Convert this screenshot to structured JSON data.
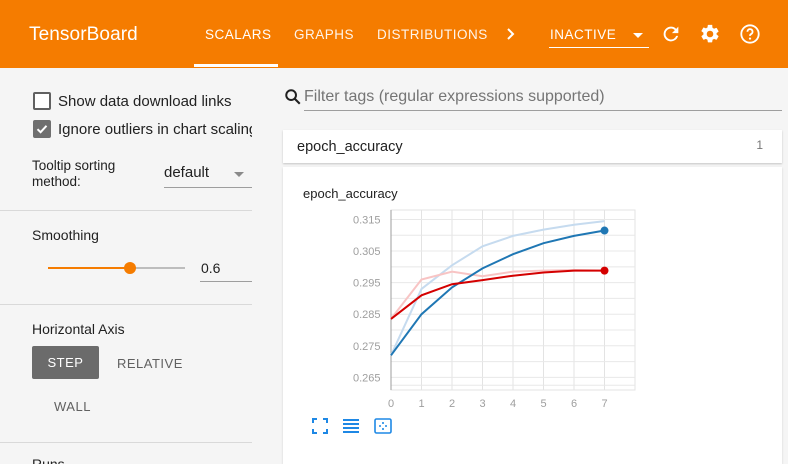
{
  "header": {
    "brand": "TensorBoard",
    "tabs": [
      {
        "label": "SCALARS",
        "active": true
      },
      {
        "label": "GRAPHS",
        "active": false
      },
      {
        "label": "DISTRIBUTIONS",
        "active": false
      }
    ],
    "status_select": "INACTIVE",
    "icons": [
      "chevron-right-icon",
      "refresh-icon",
      "settings-icon",
      "help-icon"
    ],
    "bar_color": "#f57c00"
  },
  "sidebar": {
    "show_download_links": {
      "label": "Show data download links",
      "checked": false
    },
    "ignore_outliers": {
      "label": "Ignore outliers in chart scaling",
      "checked": true
    },
    "tooltip_sorting": {
      "label": "Tooltip sorting method:",
      "value": "default"
    },
    "smoothing": {
      "label": "Smoothing",
      "value": "0.6",
      "fraction": 0.6
    },
    "horizontal_axis": {
      "label": "Horizontal Axis",
      "options": [
        "STEP",
        "RELATIVE",
        "WALL"
      ],
      "selected": "STEP"
    },
    "next_section_label": "Runs"
  },
  "main": {
    "filter_placeholder": "Filter tags (regular expressions supported)",
    "group": {
      "name": "epoch_accuracy",
      "count": "1"
    },
    "card_title": "epoch_accuracy",
    "card_buttons": [
      "fit-domain-icon",
      "toggle-log-scale-icon",
      "reset-zoom-icon"
    ]
  },
  "chart_data": {
    "type": "line",
    "title": "epoch_accuracy",
    "xlabel": "",
    "ylabel": "",
    "x": [
      0,
      1,
      2,
      3,
      4,
      5,
      6,
      7
    ],
    "xlim": [
      0,
      8
    ],
    "ylim": [
      0.261,
      0.318
    ],
    "yticks": [
      0.265,
      0.275,
      0.285,
      0.295,
      0.305,
      0.315
    ],
    "grid": true,
    "series": [
      {
        "color": "#1f77b4",
        "raw_color": "#c6dbef",
        "values": [
          0.272,
          0.285,
          0.2935,
          0.2995,
          0.304,
          0.3075,
          0.3098,
          0.3115
        ],
        "raw_values": [
          0.272,
          0.293,
          0.3005,
          0.3065,
          0.3098,
          0.3118,
          0.3133,
          0.3145
        ]
      },
      {
        "color": "#d40000",
        "raw_color": "#f8c4c4",
        "values": [
          0.2835,
          0.291,
          0.2945,
          0.2958,
          0.2972,
          0.2982,
          0.2988,
          0.2988
        ],
        "raw_values": [
          0.2835,
          0.296,
          0.2985,
          0.297,
          0.2985,
          0.2988,
          0.299,
          0.2988
        ]
      }
    ]
  }
}
